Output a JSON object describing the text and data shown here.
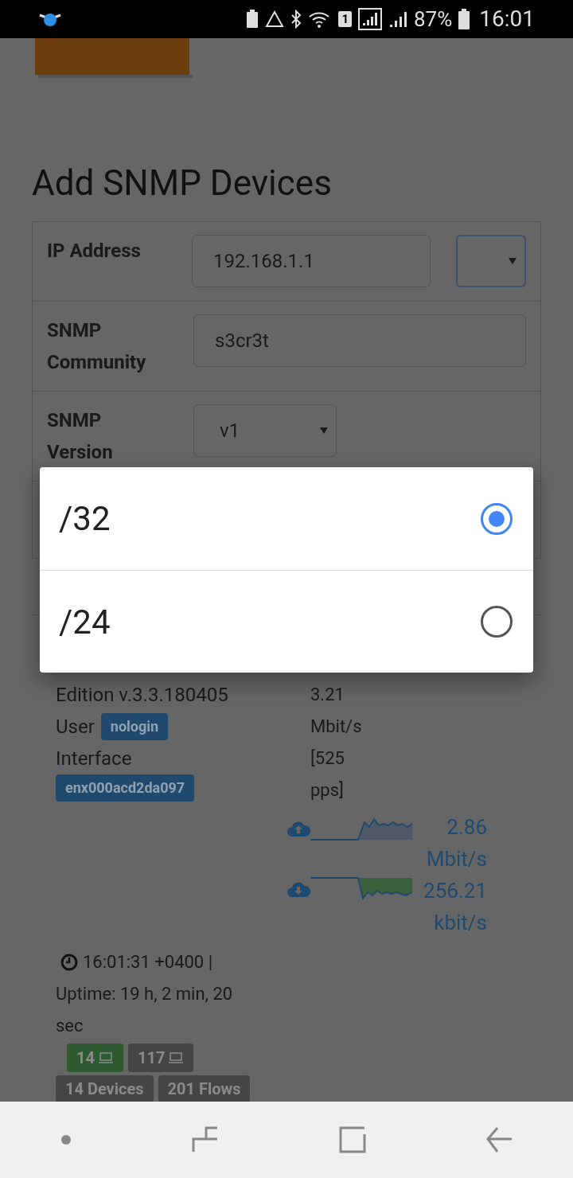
{
  "status_bar": {
    "battery_text": "87%",
    "time": "16:01",
    "sim": "1"
  },
  "title": "Add SNMP Devices",
  "form": {
    "rows": [
      {
        "kind": "ip",
        "label": "IP Address",
        "value": "192.168.1.1",
        "focused": true
      },
      {
        "kind": "text",
        "label": "SNMP Community",
        "value": "s3cr3t"
      },
      {
        "kind": "select",
        "label": "SNMP Version",
        "value": "v1"
      }
    ]
  },
  "dialog": {
    "options": [
      {
        "label": "/32",
        "selected": true
      },
      {
        "label": "/24",
        "selected": false
      }
    ]
  },
  "footer": {
    "edition": "Edition v.3.3.180405",
    "user_label": "User",
    "user": "nologin",
    "interface_label": "Interface",
    "interface": "enx000acd2da097",
    "throughput": [
      "3.21",
      "Mbit/s",
      "[525",
      "pps]"
    ],
    "upload": [
      "2.86",
      "Mbit/s"
    ],
    "download": [
      "256.21",
      "kbit/s"
    ],
    "clock": "16:01:31 +0400 |",
    "uptime": [
      "Uptime: 19 h, 2 min, 20",
      "sec"
    ],
    "hosts": [
      {
        "count": "14",
        "color": "#2f5a2f"
      },
      {
        "count": "117",
        "color": "#454545"
      }
    ],
    "totals": [
      "14 Devices",
      "201 Flows"
    ]
  }
}
